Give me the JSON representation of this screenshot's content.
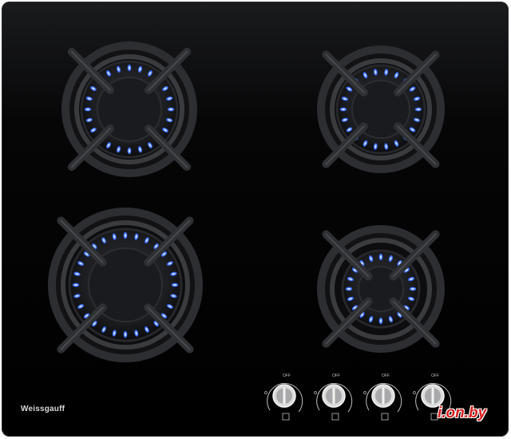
{
  "product": {
    "brand": "Weissgauff",
    "colors": {
      "glass": "#000000",
      "flame": "#3a6bff",
      "grate": "#2a2a2c"
    }
  },
  "burners": [
    {
      "id": "rear-left",
      "flame": "on"
    },
    {
      "id": "rear-right",
      "flame": "on"
    },
    {
      "id": "front-left",
      "flame": "on"
    },
    {
      "id": "front-right",
      "flame": "on"
    }
  ],
  "controls": {
    "knobs": [
      {
        "off_label": "OFF",
        "symbol": "rear-left"
      },
      {
        "off_label": "OFF",
        "symbol": "front-left"
      },
      {
        "off_label": "OFF",
        "symbol": "rear-right"
      },
      {
        "off_label": "OFF",
        "symbol": "front-right"
      }
    ]
  },
  "watermark": {
    "text": "i.on.by"
  }
}
